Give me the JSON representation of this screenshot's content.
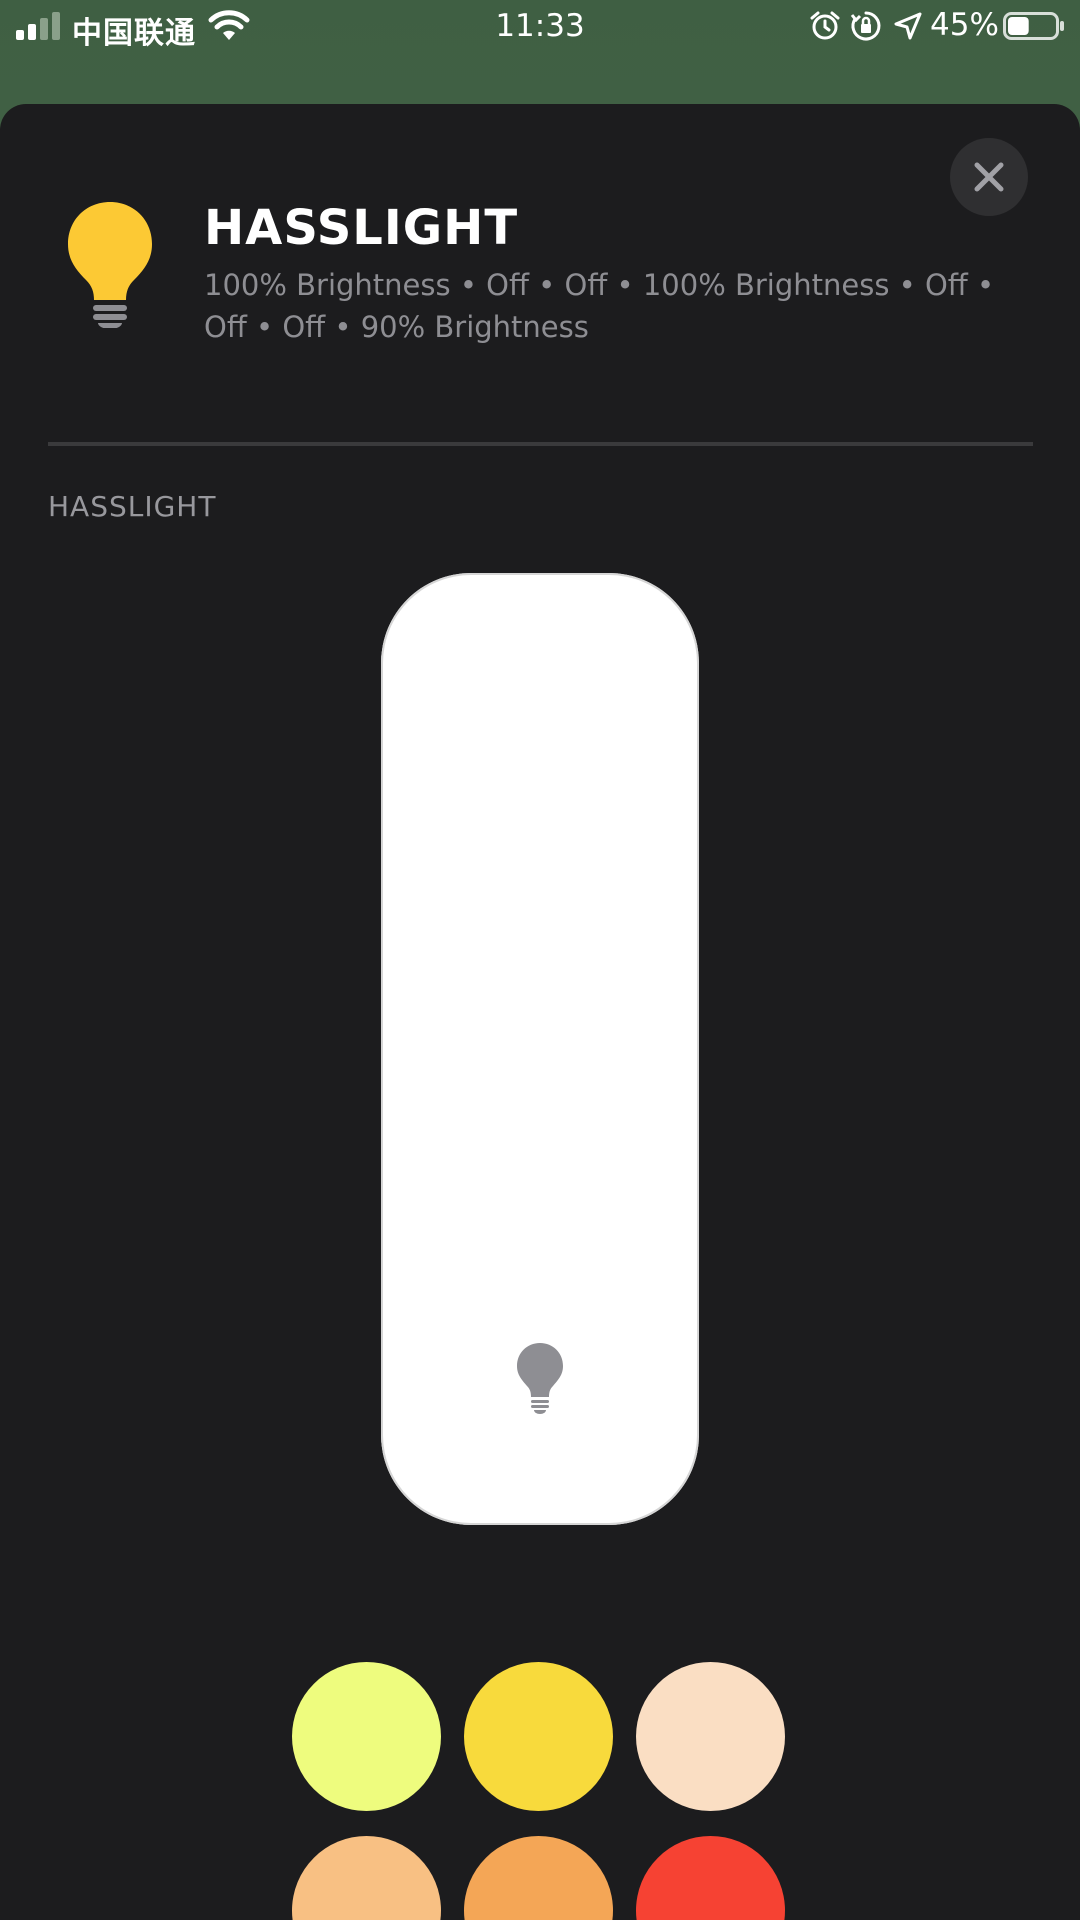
{
  "status_bar": {
    "carrier": "中国联通",
    "time": "11:33",
    "battery_percent": "45%",
    "battery_level": 0.45,
    "icons": [
      "signal-icon",
      "wifi-icon",
      "alarm-icon",
      "orientation-lock-icon",
      "location-icon",
      "battery-icon"
    ]
  },
  "header": {
    "title": "HASSLIGHT",
    "subtitle": "100% Brightness • Off • Off • 100% Brightness • Off • Off • Off • 90% Brightness",
    "icon": "lightbulb-icon",
    "icon_color": "#fcc934"
  },
  "section": {
    "label": "HASSLIGHT"
  },
  "slider": {
    "icon": "lightbulb-icon",
    "icon_color": "#8e8e93",
    "fill_color": "#ffffff"
  },
  "swatches": [
    {
      "name": "swatch-light-yellow",
      "color": "#eefc7e"
    },
    {
      "name": "swatch-yellow",
      "color": "#f8da3c"
    },
    {
      "name": "swatch-peach",
      "color": "#fadec3"
    },
    {
      "name": "swatch-light-orange",
      "color": "#f8c083"
    },
    {
      "name": "swatch-orange",
      "color": "#f4a656"
    },
    {
      "name": "swatch-red",
      "color": "#f64233"
    }
  ]
}
